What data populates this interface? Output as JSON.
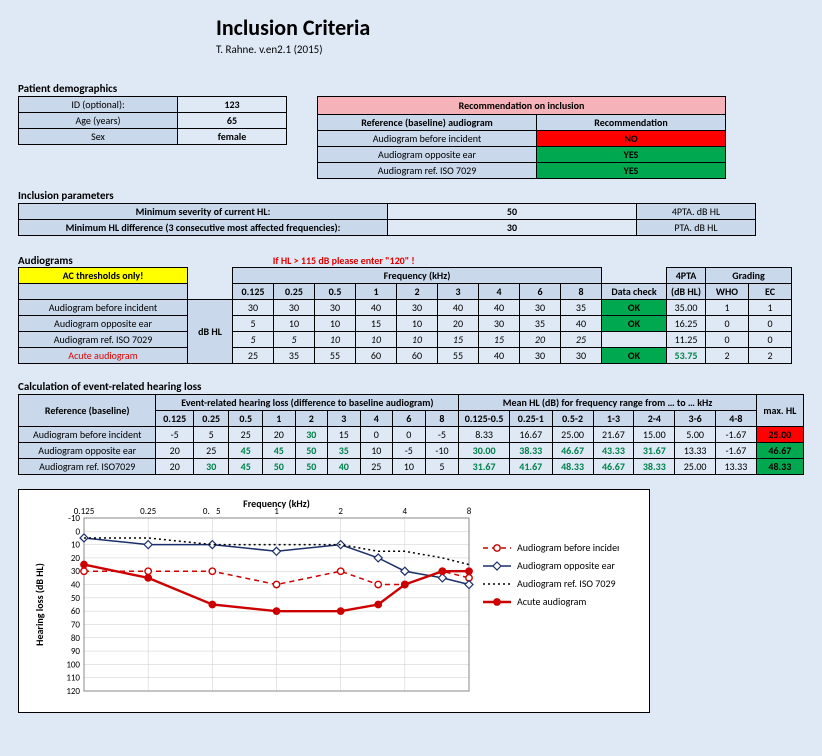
{
  "title": "Inclusion Criteria",
  "subtitle": "T. Rahne. v.en2.1 (2015)",
  "demo": {
    "head": "Patient demographics",
    "rows": [
      {
        "k": "ID (optional):",
        "v": "123"
      },
      {
        "k": "Age (years)",
        "v": "65"
      },
      {
        "k": "Sex",
        "v": "female"
      }
    ]
  },
  "rec": {
    "banner": "Recommendation on inclusion",
    "refHead": "Reference (baseline) audiogram",
    "recHead": "Recommendation",
    "rows": [
      {
        "k": "Audiogram before incident",
        "v": "NO",
        "cls": "red"
      },
      {
        "k": "Audiogram opposite ear",
        "v": "YES",
        "cls": "green"
      },
      {
        "k": "Audiogram ref. ISO 7029",
        "v": "YES",
        "cls": "green"
      }
    ]
  },
  "incl": {
    "head": "Inclusion parameters",
    "rows": [
      {
        "k": "Minimum severity of current HL:",
        "v": "50",
        "u": "4PTA. dB HL"
      },
      {
        "k": "Minimum HL difference (3 consecutive most affected frequencies):",
        "v": "30",
        "u": "PTA. dB HL"
      }
    ]
  },
  "aud": {
    "head": "Audiograms",
    "note": "If HL > 115 dB please enter \"120\" !",
    "ac": "AC thresholds only!",
    "unit": "dB HL",
    "freqHead": "Frequency (kHz)",
    "freqs": [
      "0.125",
      "0.25",
      "0.5",
      "1",
      "2",
      "3",
      "4",
      "6",
      "8"
    ],
    "dataCheck": "Data check",
    "fourPTA": "4PTA",
    "fourPTAsub": "(dB HL)",
    "grading": "Grading",
    "gradeCols": [
      "WHO",
      "EC"
    ],
    "rows": [
      {
        "name": "Audiogram before incident",
        "vals": [
          "30",
          "30",
          "30",
          "40",
          "30",
          "40",
          "40",
          "30",
          "35"
        ],
        "dc": "OK",
        "pta": "35.00",
        "who": "1",
        "ec": "1",
        "dcCls": "green"
      },
      {
        "name": "Audiogram opposite ear",
        "vals": [
          "5",
          "10",
          "10",
          "15",
          "10",
          "20",
          "30",
          "35",
          "40"
        ],
        "dc": "OK",
        "pta": "16.25",
        "who": "0",
        "ec": "0",
        "dcCls": "green"
      },
      {
        "name": "Audiogram ref. ISO 7029",
        "vals": [
          "5",
          "5",
          "10",
          "10",
          "10",
          "15",
          "15",
          "20",
          "25"
        ],
        "dc": "",
        "pta": "11.25",
        "who": "0",
        "ec": "0",
        "ital": true
      },
      {
        "name": "Acute audiogram",
        "vals": [
          "25",
          "35",
          "55",
          "60",
          "60",
          "55",
          "40",
          "30",
          "30"
        ],
        "dc": "OK",
        "pta": "53.75",
        "who": "2",
        "ec": "2",
        "dcCls": "green",
        "nameCls": "redT",
        "ptaCls": "greenT"
      }
    ]
  },
  "calc": {
    "head": "Calculation of event-related hearing loss",
    "refHead": "Reference (baseline)",
    "diffHead": "Event-related hearing loss (difference to baseline audiogram)",
    "meanHead": "Mean HL (dB) for frequency range from … to … kHz",
    "maxHead": "max. HL",
    "freqs": [
      "0.125",
      "0.25",
      "0.5",
      "1",
      "2",
      "3",
      "4",
      "6",
      "8"
    ],
    "ranges": [
      "0.125-0.5",
      "0.25-1",
      "0.5-2",
      "1-3",
      "2-4",
      "3-6",
      "4-8"
    ],
    "rows": [
      {
        "name": "Audiogram before incident",
        "diff": [
          "-5",
          "5",
          "25",
          "20",
          "30",
          "15",
          "0",
          "0",
          "-5"
        ],
        "diffCls": [
          "",
          "",
          "",
          "",
          "greenT",
          "",
          "",
          "",
          ""
        ],
        "mean": [
          "8.33",
          "16.67",
          "25.00",
          "21.67",
          "15.00",
          "5.00",
          "-1.67"
        ],
        "meanCls": [
          "",
          "",
          "",
          "",
          "",
          "",
          ""
        ],
        "max": "25.00",
        "maxCls": "red"
      },
      {
        "name": "Audiogram opposite ear",
        "diff": [
          "20",
          "25",
          "45",
          "45",
          "50",
          "35",
          "10",
          "-5",
          "-10"
        ],
        "diffCls": [
          "",
          "",
          "greenT",
          "greenT",
          "greenT",
          "greenT",
          "",
          "",
          ""
        ],
        "mean": [
          "30.00",
          "38.33",
          "46.67",
          "43.33",
          "31.67",
          "13.33",
          "-1.67"
        ],
        "meanCls": [
          "greenT",
          "greenT",
          "greenT",
          "greenT",
          "greenT",
          "",
          ""
        ],
        "max": "46.67",
        "maxCls": "green"
      },
      {
        "name": "Audiogram ref. ISO7029",
        "diff": [
          "20",
          "30",
          "45",
          "50",
          "50",
          "40",
          "25",
          "10",
          "5"
        ],
        "diffCls": [
          "",
          "greenT",
          "greenT",
          "greenT",
          "greenT",
          "greenT",
          "",
          "",
          ""
        ],
        "mean": [
          "31.67",
          "41.67",
          "48.33",
          "46.67",
          "38.33",
          "25.00",
          "13.33"
        ],
        "meanCls": [
          "greenT",
          "greenT",
          "greenT",
          "greenT",
          "greenT",
          "",
          ""
        ],
        "max": "48.33",
        "maxCls": "green"
      }
    ]
  },
  "chart_data": {
    "type": "line",
    "title": "Frequency (kHz)",
    "xlabel": "Frequency (kHz)",
    "ylabel": "Hearing loss (dB HL)",
    "x_ticks": [
      "0.125",
      "0.25",
      "0.",
      "5",
      "1",
      "2",
      "4",
      "8"
    ],
    "ylim": [
      -10,
      120
    ],
    "legend": [
      "Audiogram before incident",
      "Audiogram opposite ear",
      "Audiogram ref. ISO 7029",
      "Acute audiogram"
    ],
    "categories": [
      0.125,
      0.25,
      0.5,
      1,
      2,
      3,
      4,
      6,
      8
    ],
    "series": [
      {
        "name": "Audiogram before incident",
        "values": [
          30,
          30,
          30,
          40,
          30,
          40,
          40,
          30,
          35
        ],
        "style": "dash-red-open"
      },
      {
        "name": "Audiogram opposite ear",
        "values": [
          5,
          10,
          10,
          15,
          10,
          20,
          30,
          35,
          40
        ],
        "style": "solid-navy-diamond"
      },
      {
        "name": "Audiogram ref. ISO 7029",
        "values": [
          5,
          5,
          10,
          10,
          10,
          15,
          15,
          20,
          25
        ],
        "style": "dotted-black"
      },
      {
        "name": "Acute audiogram",
        "values": [
          25,
          35,
          55,
          60,
          60,
          55,
          40,
          30,
          30
        ],
        "style": "solid-red-filled"
      }
    ]
  }
}
